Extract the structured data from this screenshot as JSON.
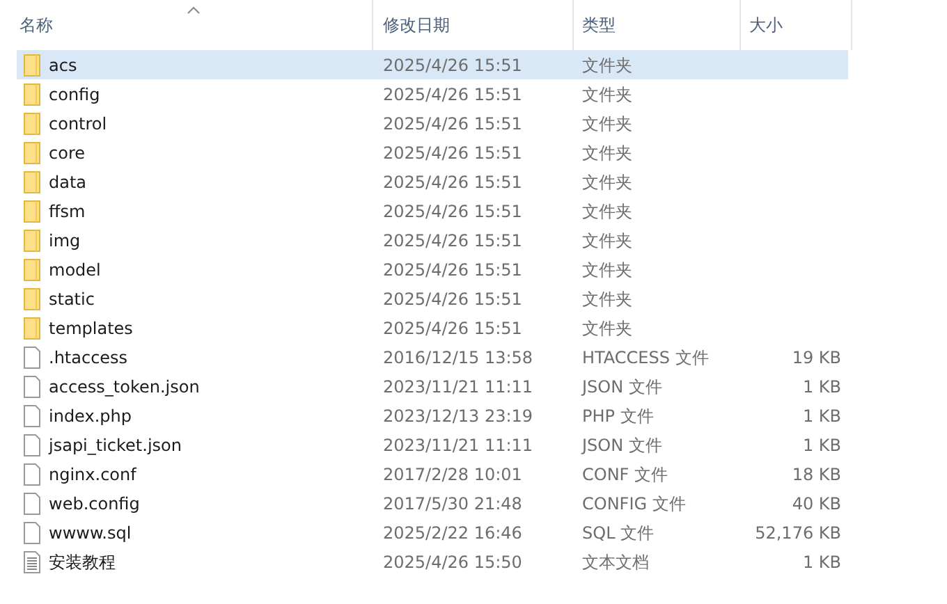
{
  "columns": [
    "名称",
    "修改日期",
    "类型",
    "大小"
  ],
  "rows": [
    {
      "kind": "folder",
      "name": "acs",
      "date": "2025/4/26 15:51",
      "type": "文件夹",
      "selected": true
    },
    {
      "kind": "folder",
      "name": "config",
      "date": "2025/4/26 15:51",
      "type": "文件夹",
      "selected": false
    },
    {
      "kind": "folder",
      "name": "control",
      "date": "2025/4/26 15:51",
      "type": "文件夹",
      "selected": false
    },
    {
      "kind": "folder",
      "name": "core",
      "date": "2025/4/26 15:51",
      "type": "文件夹",
      "selected": false
    },
    {
      "kind": "folder",
      "name": "data",
      "date": "2025/4/26 15:51",
      "type": "文件夹",
      "selected": false
    },
    {
      "kind": "folder",
      "name": "ffsm",
      "date": "2025/4/26 15:51",
      "type": "文件夹",
      "selected": false
    },
    {
      "kind": "folder",
      "name": "img",
      "date": "2025/4/26 15:51",
      "type": "文件夹",
      "selected": false
    },
    {
      "kind": "folder",
      "name": "model",
      "date": "2025/4/26 15:51",
      "type": "文件夹",
      "selected": false
    },
    {
      "kind": "folder",
      "name": "static",
      "date": "2025/4/26 15:51",
      "type": "文件夹",
      "selected": false
    },
    {
      "kind": "folder",
      "name": "templates",
      "date": "2025/4/26 15:51",
      "type": "文件夹",
      "selected": false
    },
    {
      "kind": "file",
      "name": ".htaccess",
      "date": "2016/12/15 13:58",
      "type": "HTACCESS 文件",
      "size": "19 KB",
      "selected": false
    },
    {
      "kind": "file",
      "name": "access_token.json",
      "date": "2023/11/21 11:11",
      "type": "JSON 文件",
      "size": "1 KB",
      "selected": false
    },
    {
      "kind": "file",
      "name": "index.php",
      "date": "2023/12/13 23:19",
      "type": "PHP 文件",
      "size": "1 KB",
      "selected": false
    },
    {
      "kind": "file",
      "name": "jsapi_ticket.json",
      "date": "2023/11/21 11:11",
      "type": "JSON 文件",
      "size": "1 KB",
      "selected": false
    },
    {
      "kind": "file",
      "name": "nginx.conf",
      "date": "2017/2/28 10:01",
      "type": "CONF 文件",
      "size": "18 KB",
      "selected": false
    },
    {
      "kind": "file",
      "name": "web.config",
      "date": "2017/5/30 21:48",
      "type": "CONFIG 文件",
      "size": "40 KB",
      "selected": false
    },
    {
      "kind": "file",
      "name": "wwww.sql",
      "date": "2025/2/22 16:46",
      "type": "SQL 文件",
      "size": "52,176 KB",
      "selected": false
    },
    {
      "kind": "text",
      "name": "安装教程",
      "date": "2025/4/26 15:50",
      "type": "文本文档",
      "size": "1 KB",
      "selected": false
    }
  ]
}
